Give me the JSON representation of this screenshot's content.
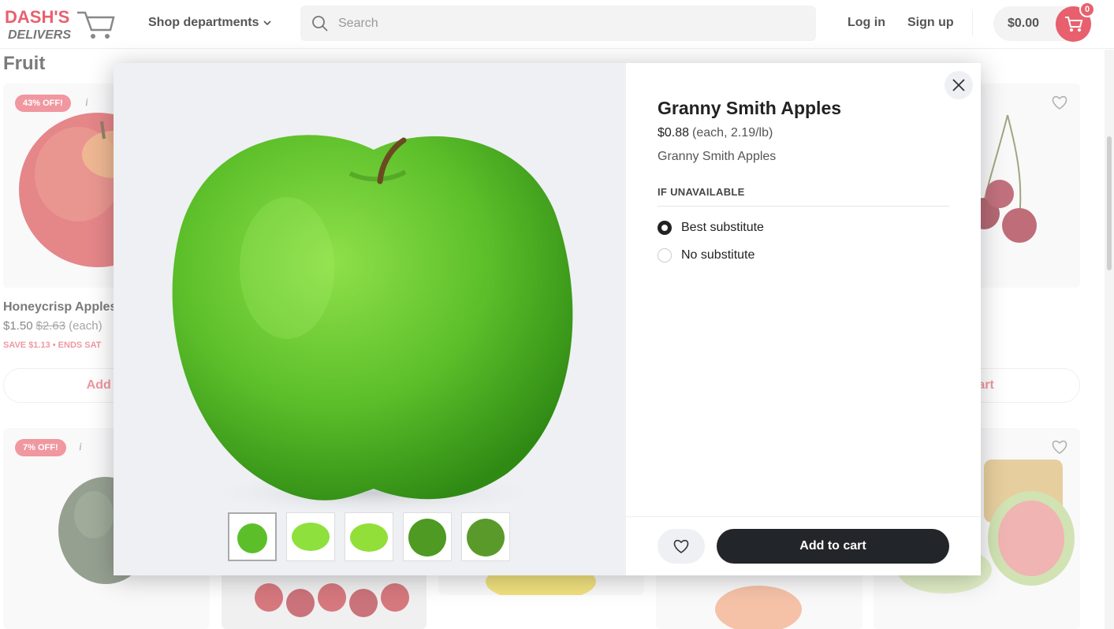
{
  "header": {
    "logo_top": "DASH'S",
    "logo_bottom": "DELIVERS",
    "shop_departments": "Shop departments",
    "search_placeholder": "Search",
    "login": "Log in",
    "signup": "Sign up",
    "cart_total": "$0.00",
    "cart_count": "0"
  },
  "page": {
    "section_title": "Fruit",
    "cards": [
      {
        "badge": "43% OFF!",
        "info": "i",
        "name": "Honeycrisp Apples",
        "price": "$1.50",
        "was": "$2.63",
        "unit": "(each)",
        "save": "SAVE $1.13 • ENDS SAT",
        "add": "Add to"
      },
      {
        "add": "o cart"
      },
      {
        "badge": "7% OFF!",
        "info": "i"
      }
    ]
  },
  "modal": {
    "title": "Granny Smith Apples",
    "price": "$0.88",
    "unit": "(each, 2.19/lb)",
    "description": "Granny Smith Apples",
    "section": "IF UNAVAILABLE",
    "options": [
      "Best substitute",
      "No substitute"
    ],
    "selected_option": "Best substitute",
    "add_to_cart": "Add to cart"
  },
  "colors": {
    "accent": "#e8606e",
    "dark_button": "#222529",
    "apple_green": "#5cbf2a"
  },
  "icons": [
    "search-icon",
    "chevron-down-icon",
    "cart-icon",
    "close-icon",
    "heart-icon",
    "info-icon"
  ]
}
